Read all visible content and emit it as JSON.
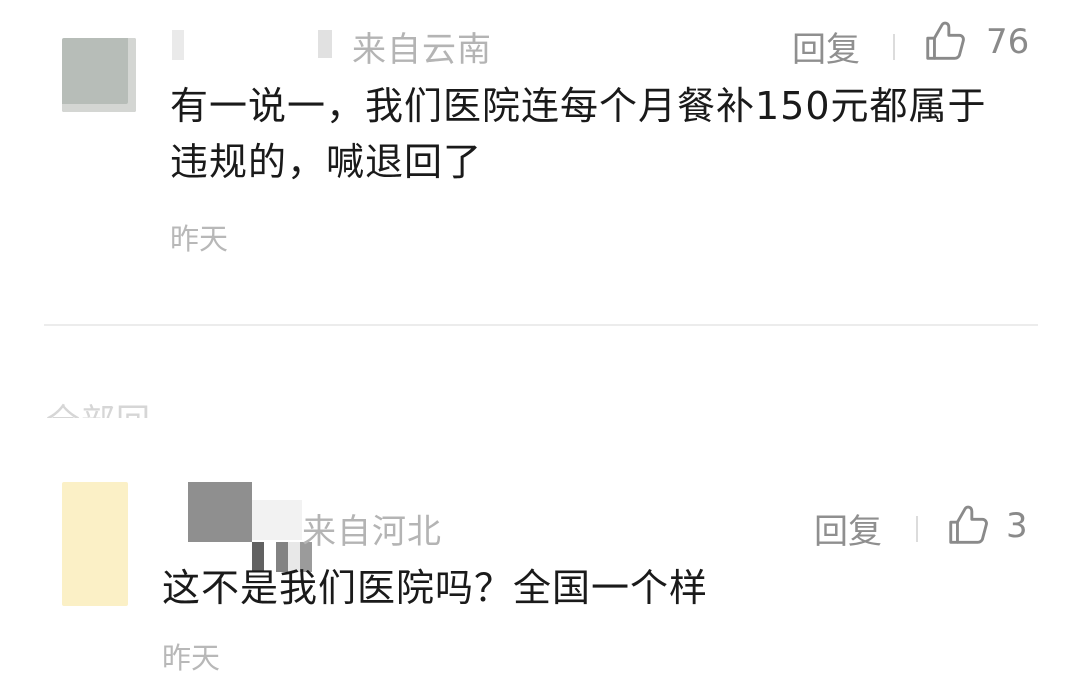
{
  "comments": [
    {
      "location": "来自云南",
      "reply_label": "回复",
      "like_count": "76",
      "text": "有一说一，我们医院连每个月餐补150元都属于违规的，喊退回了",
      "time": "昨天"
    },
    {
      "location": "来自河北",
      "reply_label": "回复",
      "like_count": "3",
      "text": "这不是我们医院吗？全国一个样",
      "time": "昨天"
    }
  ],
  "section": {
    "label": "全部回"
  },
  "icons": {
    "like": "thumbs-up-icon"
  },
  "colors": {
    "text_primary": "#1a1a1a",
    "text_secondary": "#8f8f8f",
    "text_muted": "#b4b4b4"
  }
}
